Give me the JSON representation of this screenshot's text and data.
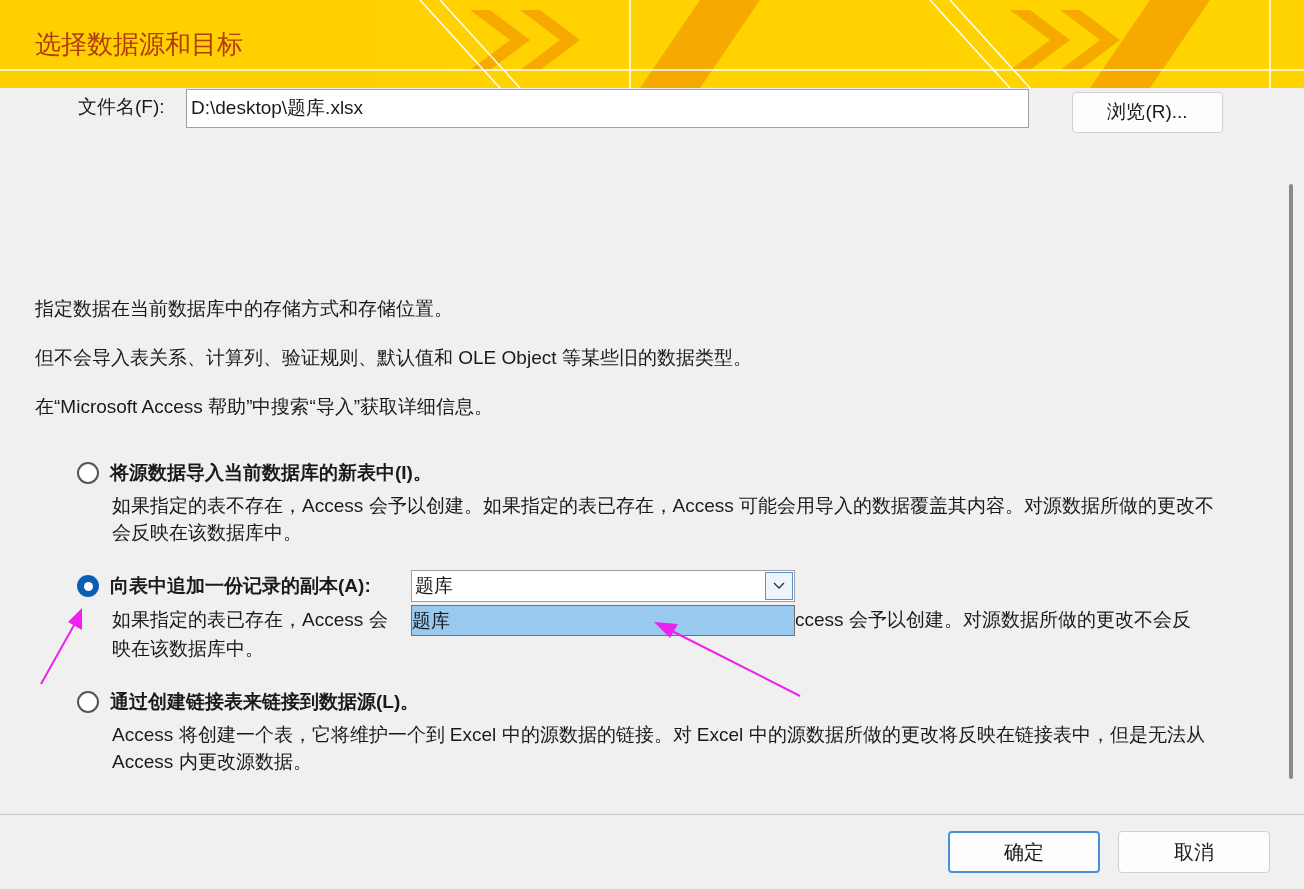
{
  "window": {
    "title": "选择数据源和目标"
  },
  "file": {
    "label": "文件名(F):",
    "value": "D:\\desktop\\题库.xlsx",
    "browse_button": "浏览(R)..."
  },
  "info": [
    "指定数据在当前数据库中的存储方式和存储位置。",
    "但不会导入表关系、计算列、验证规则、默认值和 OLE Object 等某些旧的数据类型。",
    "在“Microsoft Access 帮助”中搜索“导入”获取详细信息。"
  ],
  "options": [
    {
      "kind": "plain",
      "label": "将源数据导入当前数据库的新表中(I)。",
      "selected": false,
      "description": "如果指定的表不存在，Access 会予以创建。如果指定的表已存在，Access 可能会用导入的数据覆盖其内容。对源数据所做的更改不会反映在该数据库中。"
    },
    {
      "kind": "append",
      "label": "向表中追加一份记录的副本(A):",
      "selected": true,
      "combobox": {
        "value": "题库",
        "list": [
          {
            "label": "题库",
            "selected": true
          }
        ]
      },
      "description_parts": [
        "如果指定的表已存在，Access 会",
        "ccess 会予以创建。对源数据所做的更改不会反",
        "映在该数据库中。"
      ]
    },
    {
      "kind": "plain",
      "label": "通过创建链接表来链接到数据源(L)。",
      "selected": false,
      "description": "Access 将创建一个表，它将维护一个到 Excel 中的源数据的链接。对 Excel 中的源数据所做的更改将反映在链接表中，但是无法从 Access 内更改源数据。"
    }
  ],
  "buttons": [
    {
      "label": "确定",
      "default": true
    },
    {
      "label": "取消",
      "default": false
    }
  ]
}
